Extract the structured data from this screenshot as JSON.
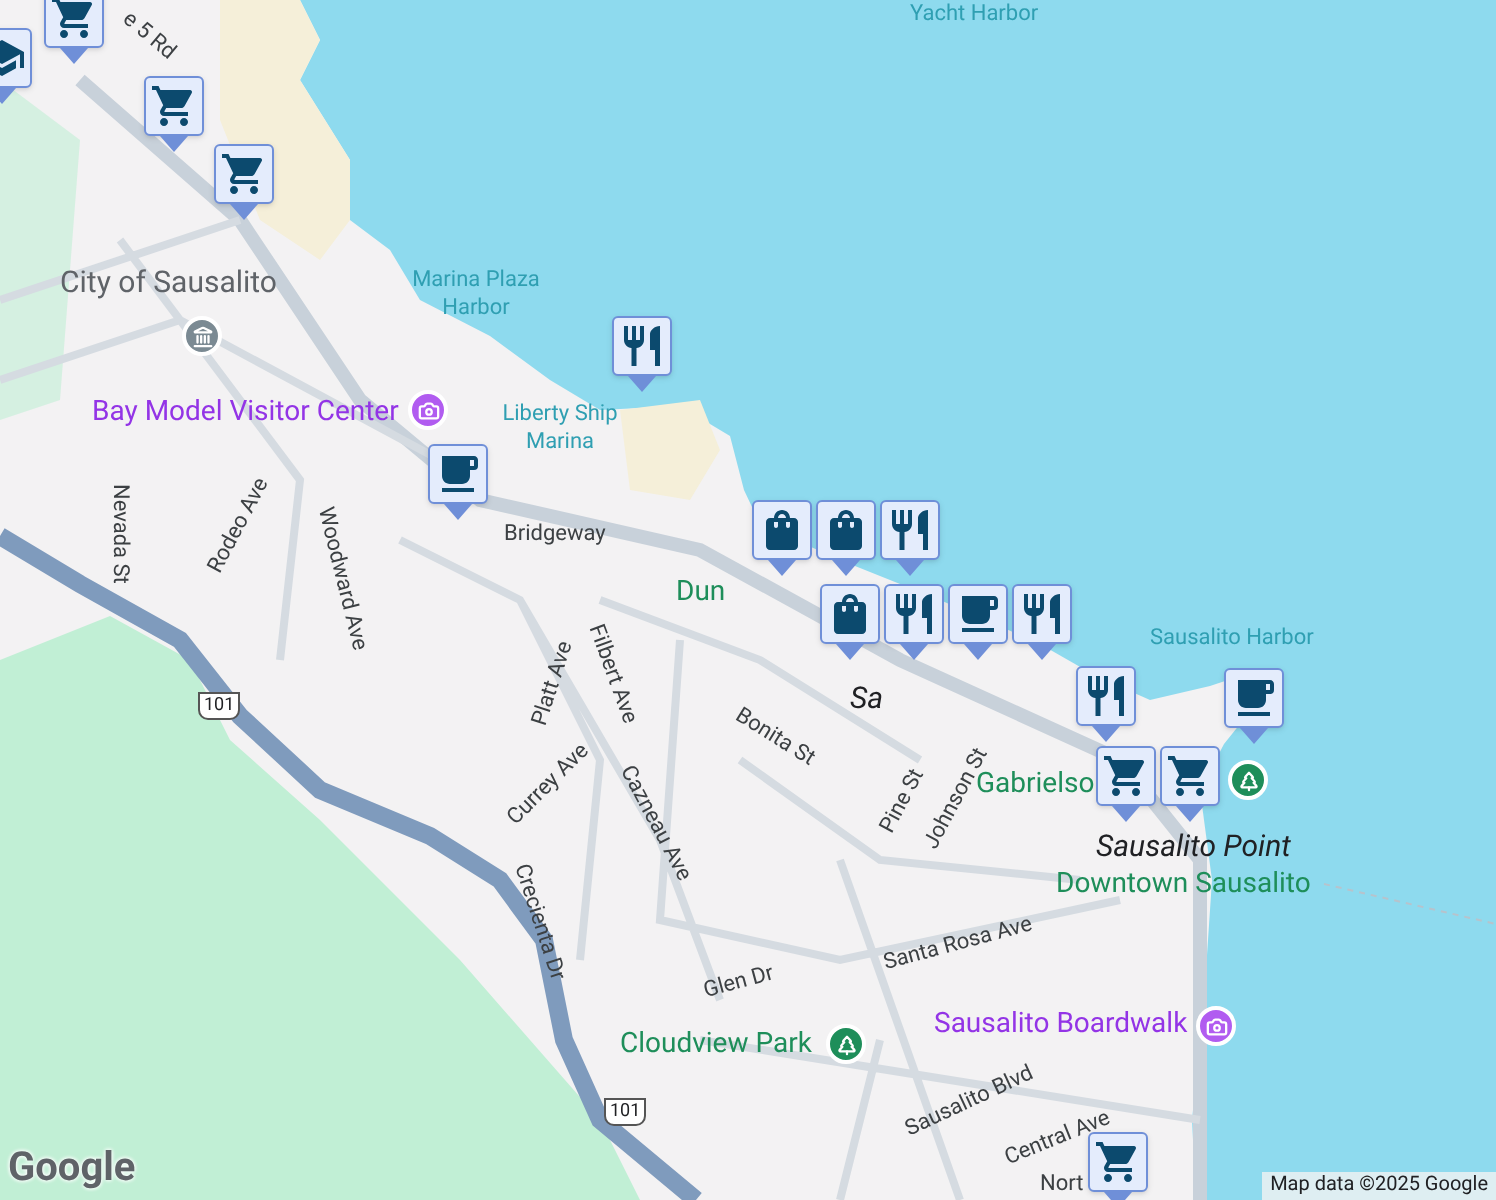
{
  "labels": [
    {
      "kind": "water",
      "text": "Yacht Harbor"
    },
    {
      "kind": "street",
      "text": "e 5 Rd"
    },
    {
      "kind": "place",
      "text": "City of Sausalito"
    },
    {
      "kind": "water",
      "text": "Marina Plaza Harbor"
    },
    {
      "kind": "poi",
      "text": "Bay Model Visitor Center"
    },
    {
      "kind": "water",
      "text": "Liberty Ship Marina"
    },
    {
      "kind": "street",
      "text": "Bridgeway"
    },
    {
      "kind": "street",
      "text": "Nevada St"
    },
    {
      "kind": "street",
      "text": "Rodeo Ave"
    },
    {
      "kind": "street",
      "text": "Woodward Ave"
    },
    {
      "kind": "park",
      "text": "Dun"
    },
    {
      "kind": "street",
      "text": "Filbert Ave"
    },
    {
      "kind": "locality",
      "text": "Sa"
    },
    {
      "kind": "street",
      "text": "Bonita St"
    },
    {
      "kind": "street",
      "text": "Platt Ave"
    },
    {
      "kind": "street",
      "text": "Cazneau Ave"
    },
    {
      "kind": "street",
      "text": "Pine St"
    },
    {
      "kind": "street",
      "text": "Johnson St"
    },
    {
      "kind": "water",
      "text": "Sausalito Harbor"
    },
    {
      "kind": "park",
      "text": "Gabrielso"
    },
    {
      "kind": "street",
      "text": "Currey Ave"
    },
    {
      "kind": "street",
      "text": "Crecienta Dr"
    },
    {
      "kind": "locality",
      "text": "Sausalito Point"
    },
    {
      "kind": "park",
      "text": "Downtown Sausalito"
    },
    {
      "kind": "street",
      "text": "Santa Rosa Ave"
    },
    {
      "kind": "street",
      "text": "Glen Dr"
    },
    {
      "kind": "park",
      "text": "Cloudview Park"
    },
    {
      "kind": "poi",
      "text": "Sausalito Boardwalk"
    },
    {
      "kind": "street",
      "text": "Sausalito Blvd"
    },
    {
      "kind": "street",
      "text": "Central Ave"
    },
    {
      "kind": "street",
      "text": "Nort"
    }
  ],
  "pins": [
    {
      "kind": "museum"
    },
    {
      "kind": "camera"
    },
    {
      "kind": "park"
    },
    {
      "kind": "camera"
    },
    {
      "kind": "park"
    }
  ],
  "shields": [
    "101",
    "101"
  ],
  "markers": [
    {
      "kind": "cap"
    },
    {
      "kind": "cart"
    },
    {
      "kind": "cart"
    },
    {
      "kind": "cart"
    },
    {
      "kind": "cutlery"
    },
    {
      "kind": "coffee"
    },
    {
      "kind": "bag"
    },
    {
      "kind": "bag"
    },
    {
      "kind": "cutlery"
    },
    {
      "kind": "bag"
    },
    {
      "kind": "cutlery"
    },
    {
      "kind": "coffee"
    },
    {
      "kind": "cutlery"
    },
    {
      "kind": "cutlery"
    },
    {
      "kind": "cart"
    },
    {
      "kind": "cart"
    },
    {
      "kind": "coffee"
    },
    {
      "kind": "cart"
    }
  ],
  "logo": "Google",
  "attribution": "Map data ©2025 Google"
}
